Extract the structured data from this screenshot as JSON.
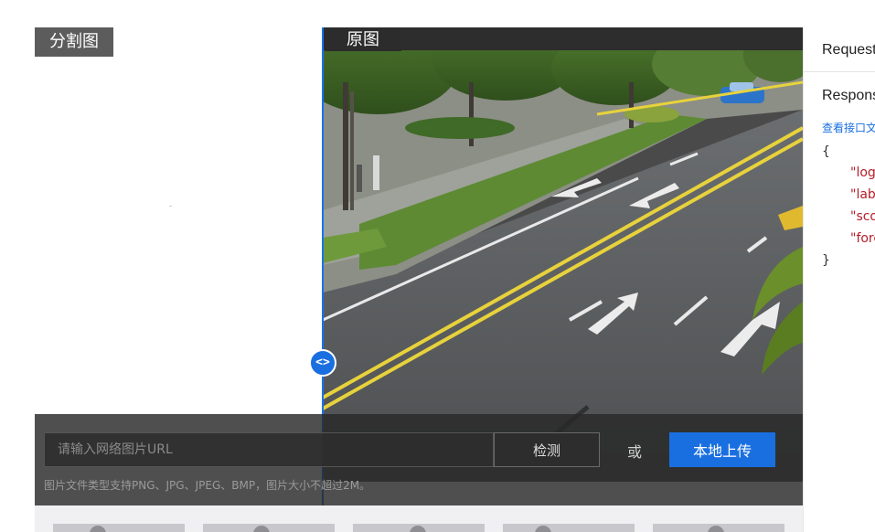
{
  "panels": {
    "segmentation_label": "分割图",
    "original_label": "原图"
  },
  "slider": {
    "handle_glyph": "<>"
  },
  "upload_bar": {
    "url_placeholder": "请输入网络图片URL",
    "detect_label": "检测",
    "or_label": "或",
    "upload_label": "本地上传",
    "hint": "图片文件类型支持PNG、JPG、JPEG、BMP，图片大小不超过2M。"
  },
  "code_panel": {
    "request_tab": "Request",
    "response_tab": "Respons",
    "doc_link": "查看接口文",
    "json_open": "{",
    "json_keys": [
      "\"log_",
      "\"labe",
      "\"sco",
      "\"fore"
    ],
    "json_close": "}"
  },
  "colors": {
    "accent": "#1a6fe0",
    "bar_bg": "#282828",
    "json_key": "#b31d28"
  },
  "icons": {
    "drag_handle": "left-right-arrows-icon"
  }
}
